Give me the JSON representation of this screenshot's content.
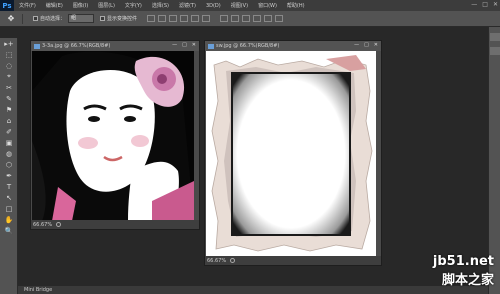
{
  "app": {
    "logo": "Ps"
  },
  "menu": [
    "文件(F)",
    "编辑(E)",
    "图像(I)",
    "图层(L)",
    "文字(Y)",
    "选择(S)",
    "滤镜(T)",
    "3D(D)",
    "视图(V)",
    "窗口(W)",
    "帮助(H)"
  ],
  "window_controls": [
    "—",
    "□",
    "✕"
  ],
  "options": {
    "auto_select_label": "自动选择：",
    "auto_select_value": "组",
    "transform_label": "显示变换控件"
  },
  "tools": [
    "▸+",
    "⬚",
    "◌",
    "⌖",
    "✂",
    "✎",
    "⚑",
    "⌂",
    "✐",
    "▣",
    "◍",
    "⬡",
    "✒",
    "T",
    "↖",
    "□",
    "✋",
    "🔍"
  ],
  "doc1": {
    "title": "3-3a.jpg @ 66.7%(RGB/8#)",
    "zoom": "66.67%"
  },
  "doc2": {
    "title": "sw.jpg @ 66.7%(RGB/8#)",
    "zoom": "66.67%"
  },
  "bottom": {
    "label": "Mini Bridge"
  },
  "watermark": {
    "line1": "jb51.net",
    "line2": "脚本之家"
  }
}
